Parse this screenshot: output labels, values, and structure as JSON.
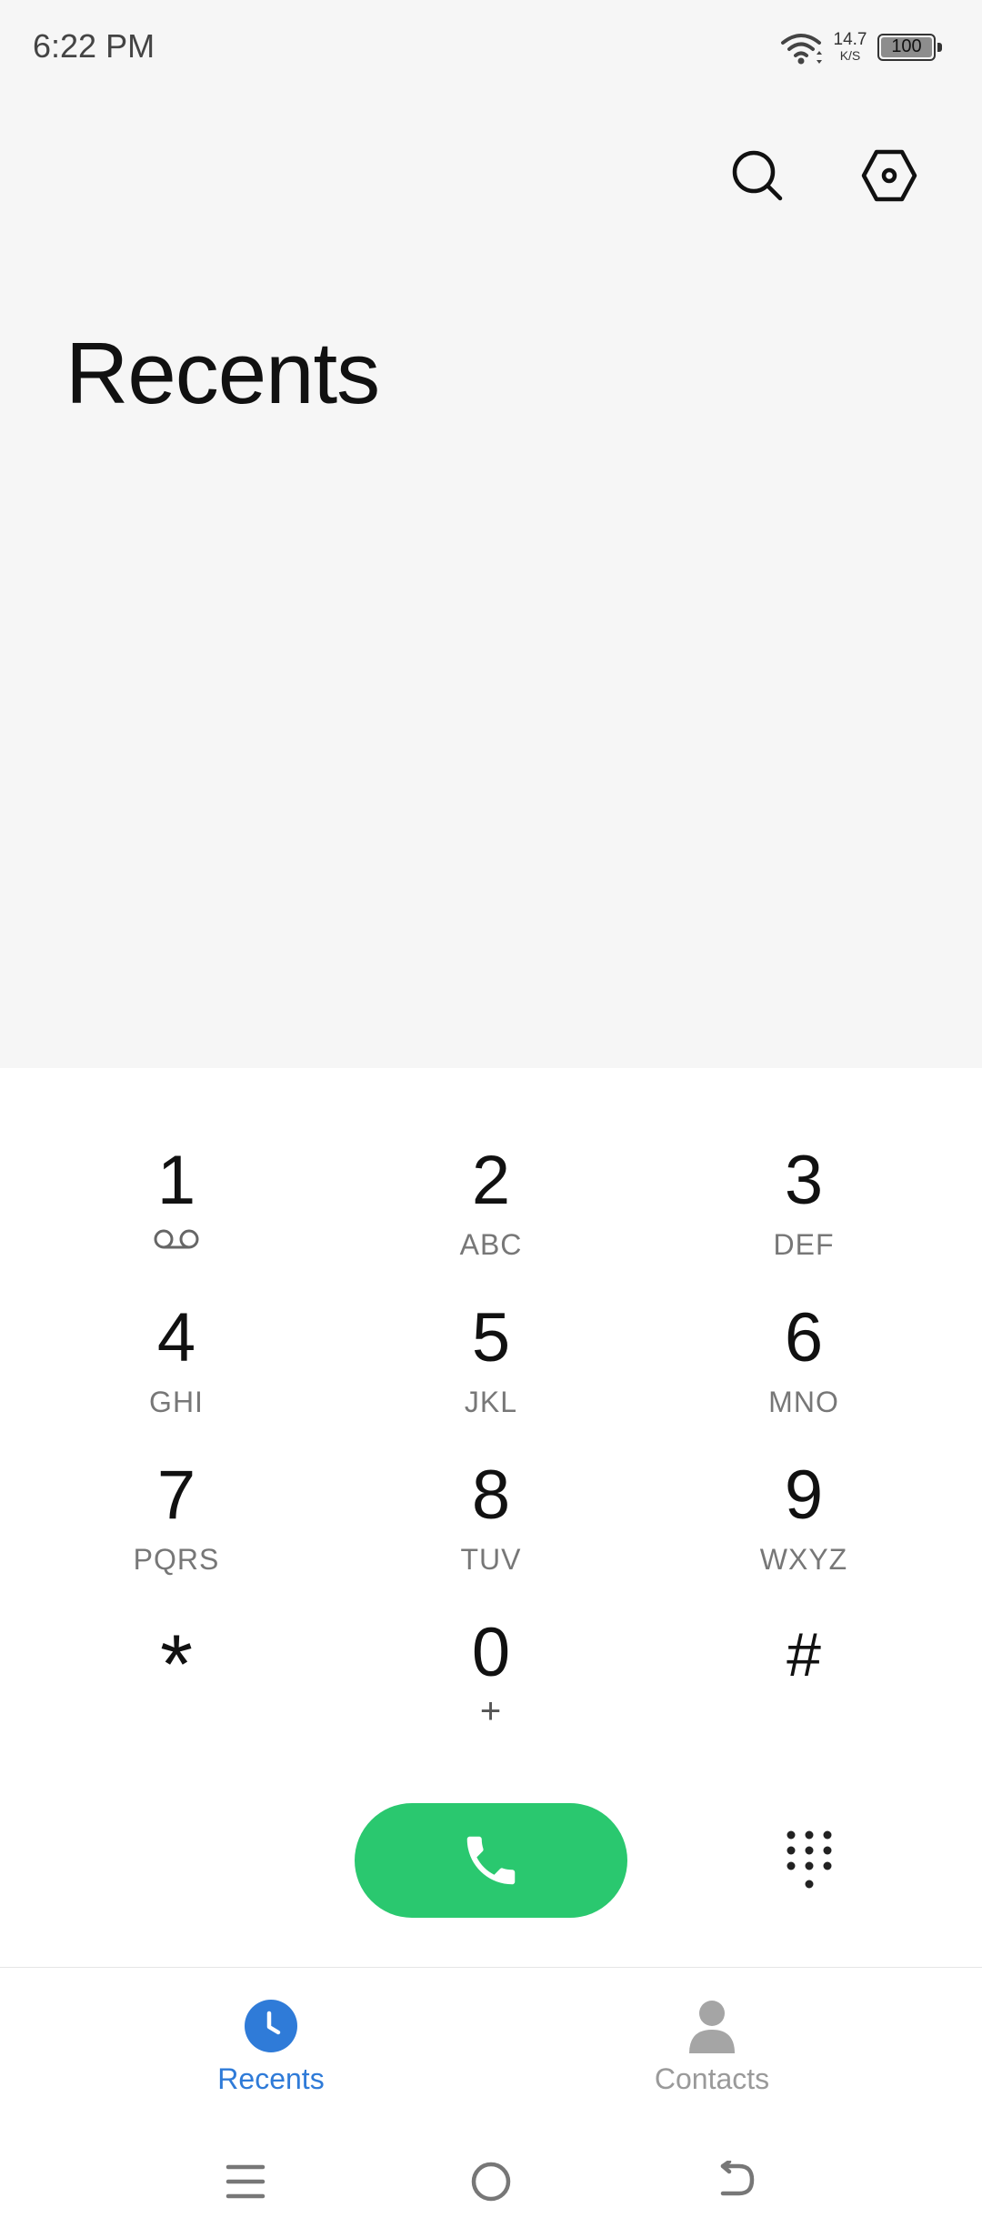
{
  "status_bar": {
    "time": "6:22 PM",
    "net_speed_value": "14.7",
    "net_speed_unit": "K/S",
    "battery": "100"
  },
  "header": {
    "title": "Recents",
    "icons": [
      "search-icon",
      "settings-icon"
    ]
  },
  "dialpad": {
    "keys": [
      {
        "digit": "1",
        "letters": "",
        "icon": "voicemail-icon"
      },
      {
        "digit": "2",
        "letters": "ABC"
      },
      {
        "digit": "3",
        "letters": "DEF"
      },
      {
        "digit": "4",
        "letters": "GHI"
      },
      {
        "digit": "5",
        "letters": "JKL"
      },
      {
        "digit": "6",
        "letters": "MNO"
      },
      {
        "digit": "7",
        "letters": "PQRS"
      },
      {
        "digit": "8",
        "letters": "TUV"
      },
      {
        "digit": "9",
        "letters": "WXYZ"
      },
      {
        "digit": "*",
        "letters": ""
      },
      {
        "digit": "0",
        "letters": "+"
      },
      {
        "digit": "#",
        "letters": ""
      }
    ]
  },
  "actions": {
    "call_icon": "phone-icon",
    "dialpad_toggle_icon": "dialpad-icon",
    "call_color": "#2ac86f"
  },
  "tabs": [
    {
      "label": "Recents",
      "icon": "clock-icon",
      "active": true,
      "color": "#2f7bd8"
    },
    {
      "label": "Contacts",
      "icon": "person-icon",
      "active": false,
      "color": "#9a9a9a"
    }
  ],
  "nav": [
    "menu-icon",
    "home-icon",
    "back-icon"
  ]
}
